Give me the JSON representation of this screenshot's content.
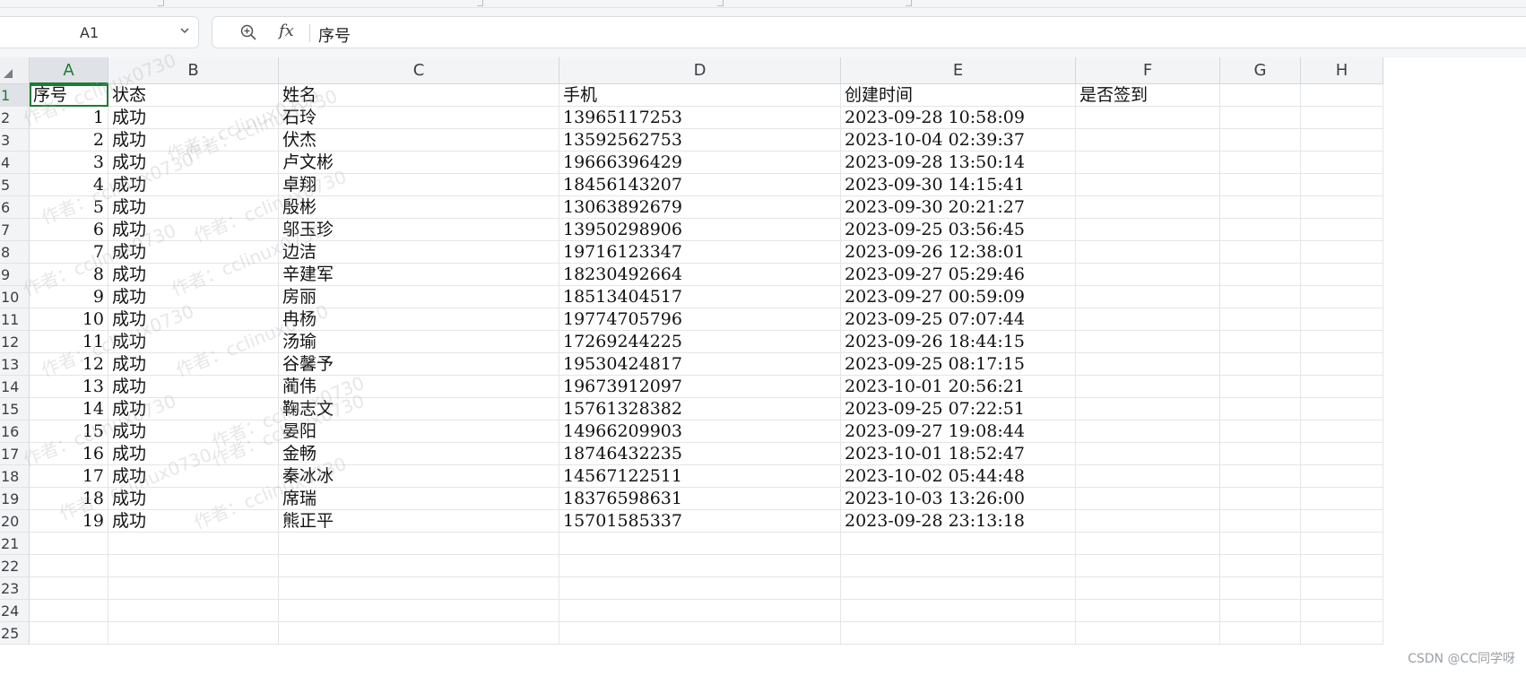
{
  "name_box": {
    "value": "A1"
  },
  "formula_bar": {
    "content": "序号"
  },
  "sheet": {
    "columns": [
      "A",
      "B",
      "C",
      "D",
      "E",
      "F",
      "G",
      "H"
    ],
    "selected_cell": "A1",
    "row_numbers": [
      "1",
      "2",
      "3",
      "4",
      "5",
      "6",
      "7",
      "8",
      "9",
      "10",
      "11",
      "12",
      "13",
      "14",
      "15",
      "16",
      "17",
      "18",
      "19",
      "20",
      "21",
      "22",
      "23",
      "24",
      "25"
    ],
    "headers": [
      "序号",
      "状态",
      "姓名",
      "手机",
      "创建时间",
      "是否签到"
    ],
    "rows": [
      [
        "1",
        "成功",
        "石玲",
        "13965117253",
        "2023-09-28 10:58:09"
      ],
      [
        "2",
        "成功",
        "伏杰",
        "13592562753",
        "2023-10-04 02:39:37"
      ],
      [
        "3",
        "成功",
        "卢文彬",
        "19666396429",
        "2023-09-28 13:50:14"
      ],
      [
        "4",
        "成功",
        "卓翔",
        "18456143207",
        "2023-09-30 14:15:41"
      ],
      [
        "5",
        "成功",
        "殷彬",
        "13063892679",
        "2023-09-30 20:21:27"
      ],
      [
        "6",
        "成功",
        "邬玉珍",
        "13950298906",
        "2023-09-25 03:56:45"
      ],
      [
        "7",
        "成功",
        "边洁",
        "19716123347",
        "2023-09-26 12:38:01"
      ],
      [
        "8",
        "成功",
        "辛建军",
        "18230492664",
        "2023-09-27 05:29:46"
      ],
      [
        "9",
        "成功",
        "房丽",
        "18513404517",
        "2023-09-27 00:59:09"
      ],
      [
        "10",
        "成功",
        "冉杨",
        "19774705796",
        "2023-09-25 07:07:44"
      ],
      [
        "11",
        "成功",
        "汤瑜",
        "17269244225",
        "2023-09-26 18:44:15"
      ],
      [
        "12",
        "成功",
        "谷馨予",
        "19530424817",
        "2023-09-25 08:17:15"
      ],
      [
        "13",
        "成功",
        "蔺伟",
        "19673912097",
        "2023-10-01 20:56:21"
      ],
      [
        "14",
        "成功",
        "鞠志文",
        "15761328382",
        "2023-09-25 07:22:51"
      ],
      [
        "15",
        "成功",
        "晏阳",
        "14966209903",
        "2023-09-27 19:08:44"
      ],
      [
        "16",
        "成功",
        "金畅",
        "18746432235",
        "2023-10-01 18:52:47"
      ],
      [
        "17",
        "成功",
        "秦冰冰",
        "14567122511",
        "2023-10-02 05:44:48"
      ],
      [
        "18",
        "成功",
        "席瑞",
        "18376598631",
        "2023-10-03 13:26:00"
      ],
      [
        "19",
        "成功",
        "熊正平",
        "15701585337",
        "2023-09-28 23:13:18"
      ]
    ]
  },
  "watermark": {
    "text": "作者：cclinux0730"
  },
  "csdn_watermark": "CSDN @CC同学呀",
  "colors": {
    "selection": "#1e7b34",
    "header_bg": "#f3f4f6",
    "gridline": "#e3e5e8"
  },
  "icons": {
    "zoom": "zoom-in-icon",
    "fx": "function-icon",
    "dropdown": "chevron-down-icon",
    "select_all": "select-all-icon"
  }
}
